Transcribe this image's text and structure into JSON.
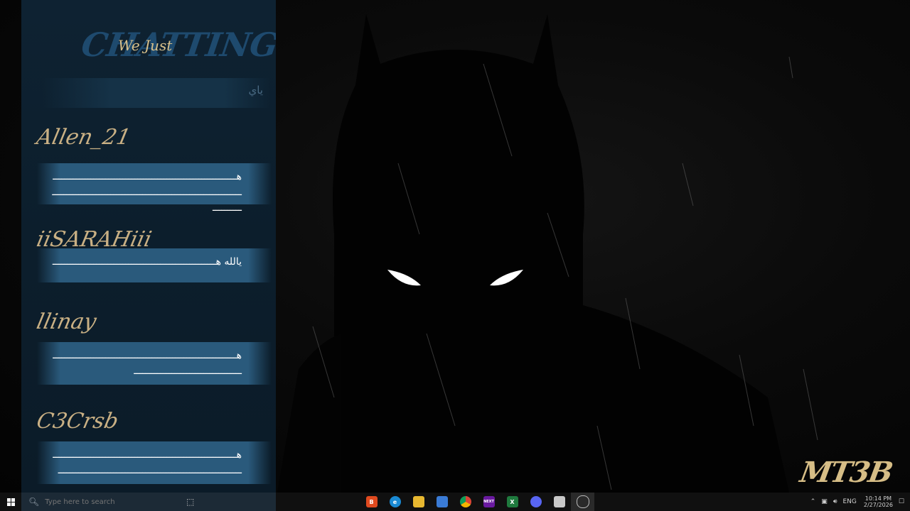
{
  "chat": {
    "header_big": "CHATTING",
    "header_small": "We Just",
    "status": "ياي",
    "messages": [
      {
        "user": "Allen_21",
        "text": "هــــــــــــــــــــــــــــــــــــــــــــــــــــــــــــــــــــــــــــــــــــــــــــــــــــــــــــــــــــــــــــــــــــــــــ"
      },
      {
        "user": "iiSARAHiii",
        "text": "يالله هــــــــــــــــــــــــــــــــــــــــــــــــــــــــ"
      },
      {
        "user": "llinay",
        "text": "هــــــــــــــــــــــــــــــــــــــــــــــــــــــــــــــــــــــــــــــــــــــــــــــــــــ"
      },
      {
        "user": "C3Crsb",
        "text": "هــــــــــــــــــــــــــــــــــــــــــــــــــــــــــــــــــــــــــــــــــــــــــــــــــــــــــــــــــــــــــــــ"
      }
    ]
  },
  "wallpaper": {
    "logo": "MT3B"
  },
  "taskbar": {
    "search_placeholder": "Type here to search",
    "apps": [
      {
        "name": "brave-icon",
        "color": "#e04a1f",
        "label": "B"
      },
      {
        "name": "edge-icon",
        "color": "#1a8ad4",
        "label": "e"
      },
      {
        "name": "file-explorer-icon",
        "color": "#e8b830",
        "label": ""
      },
      {
        "name": "store-icon",
        "color": "#3a7bd5",
        "label": ""
      },
      {
        "name": "chrome-icon",
        "color": "#e2c12a",
        "label": ""
      },
      {
        "name": "next-icon",
        "color": "#6a1aa0",
        "label": "NEXT"
      },
      {
        "name": "excel-icon",
        "color": "#1f7a3e",
        "label": "X"
      },
      {
        "name": "discord-icon",
        "color": "#5865f2",
        "label": ""
      },
      {
        "name": "notes-icon",
        "color": "#c8c8c8",
        "label": ""
      },
      {
        "name": "obs-icon",
        "color": "#2a2a2a",
        "label": ""
      }
    ],
    "language": "ENG",
    "time": "10:14 PM",
    "date": "2/27/2026"
  }
}
